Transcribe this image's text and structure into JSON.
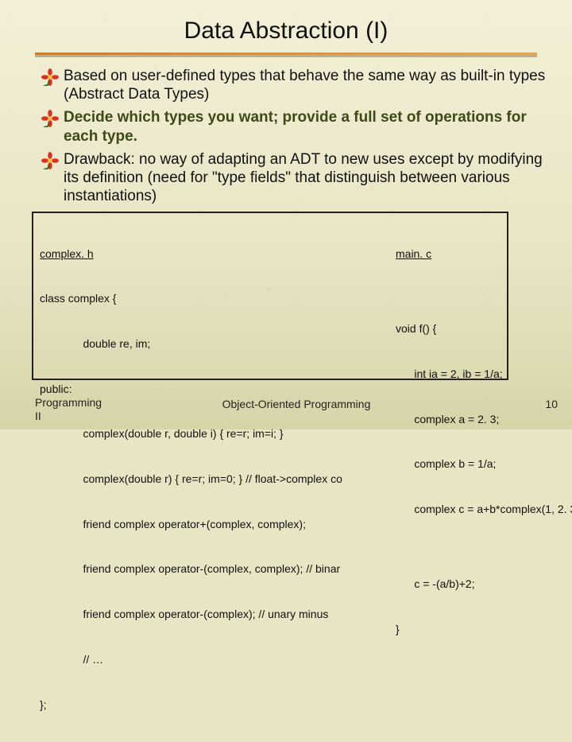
{
  "title": "Data Abstraction (I)",
  "bullets": [
    "Based on user-defined types that behave the same way as built-in types (Abstract Data Types)",
    "Decide which types you want; provide a full set of operations for each type.",
    "Drawback: no way of adapting an ADT to new uses except by modifying its definition (need for \"type fields\" that distinguish between various instantiations)"
  ],
  "code": {
    "left_heading": "complex. h",
    "left_lines": [
      "class complex {",
      "              double re, im;",
      "public:",
      "              complex(double r, double i) { re=r; im=i; }",
      "              complex(double r) { re=r; im=0; } // float->complex co",
      "              friend complex operator+(complex, complex);",
      "              friend complex operator-(complex, complex); // binar",
      "              friend complex operator-(complex); // unary minus",
      "              // …",
      "};"
    ],
    "right_heading": "main. c",
    "right_lines": [
      "",
      "void f() {",
      "      int ia = 2, ib = 1/a;",
      "      complex a = 2. 3;",
      "      complex b = 1/a;",
      "      complex c = a+b*complex(1, 2. 3",
      "",
      "      c = -(a/b)+2;",
      "}"
    ]
  },
  "footer": {
    "left": "Programming\nII",
    "center": "Object-Oriented Programming",
    "page": "10"
  },
  "icons": {
    "bullet": "flower-bullet-icon"
  }
}
